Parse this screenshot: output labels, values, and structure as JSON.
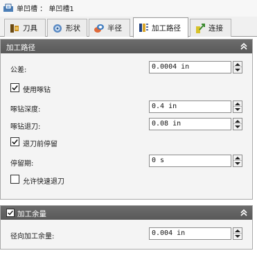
{
  "window": {
    "title": "单凹槽 ： 单凹槽1",
    "icon": "pocket-feature-icon"
  },
  "tabs": [
    {
      "label": "刀具",
      "icon": "tool-icon",
      "active": false
    },
    {
      "label": "形状",
      "icon": "shape-icon",
      "active": false
    },
    {
      "label": "半径",
      "icon": "radius-icon",
      "active": false
    },
    {
      "label": "加工路径",
      "icon": "toolpath-icon",
      "active": true
    },
    {
      "label": "连接",
      "icon": "links-icon",
      "active": false
    }
  ],
  "toolpath_panel": {
    "title": "加工路径",
    "collapse_icon": "double-chevron-up-icon",
    "tolerance": {
      "label": "公差:",
      "value": "0.0004 in"
    },
    "use_peck": {
      "label": "使用啄钻",
      "checked": true
    },
    "peck_depth": {
      "label": "啄钻深度:",
      "value": "0.4 in"
    },
    "peck_retract": {
      "label": "啄钻退刀:",
      "value": "0.08 in"
    },
    "dwell_before_retract": {
      "label": "退刀前停留",
      "checked": true
    },
    "dwell_period": {
      "label": "停留期:",
      "value": "0 s"
    },
    "allow_rapid_retract": {
      "label": "允许快速退刀",
      "checked": false
    }
  },
  "stock_panel": {
    "title": "加工余量",
    "enabled": true,
    "collapse_icon": "double-chevron-up-icon",
    "radial_stock": {
      "label": "径向加工余量:",
      "value": "0.004 in"
    }
  },
  "colors": {
    "panel_header": "#5f5f5f",
    "panel_bg": "#f4f4f4",
    "tab_active": "#ffffff"
  }
}
